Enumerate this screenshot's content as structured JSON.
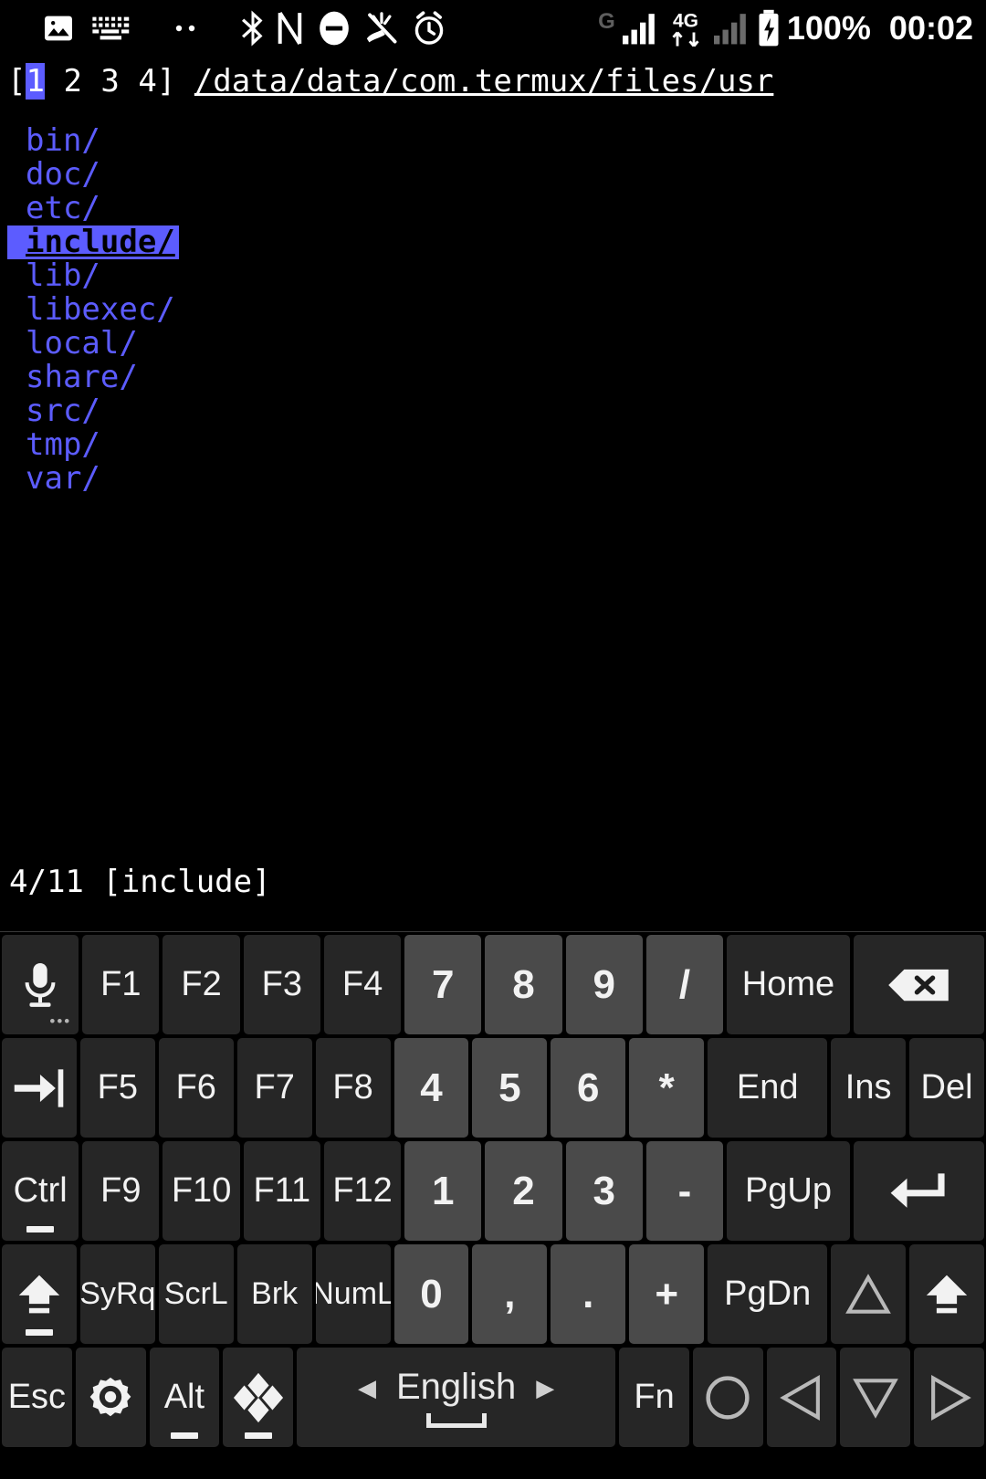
{
  "status_bar": {
    "icons_left": [
      "gallery-icon",
      "keyboard-icon",
      "two-dots-icon",
      "bluetooth-icon",
      "nfc-icon",
      "do-not-disturb-icon",
      "mute-icon",
      "alarm-icon"
    ],
    "icons_right": [
      "g-network-icon",
      "signal-bars-icon",
      "4g-data-icon",
      "signal-bars-2-icon",
      "battery-charging-icon"
    ],
    "battery_text": "100%",
    "clock_text": "00:02"
  },
  "terminal": {
    "tabs_prefix": "[",
    "tabs": [
      "1",
      "2",
      "3",
      "4"
    ],
    "tabs_suffix": "]",
    "active_tab": "1",
    "path": "/data/data/com.termux/files/usr",
    "files": [
      "bin/",
      "doc/",
      "etc/",
      "include/",
      "lib/",
      "libexec/",
      "local/",
      "share/",
      "src/",
      "tmp/",
      "var/"
    ],
    "selected_index": 3,
    "status_line": "4/11 [include]"
  },
  "keyboard": {
    "rows": [
      [
        {
          "name": "mic-key",
          "label": "",
          "icon": "mic-icon",
          "dots": true
        },
        {
          "name": "f1-key",
          "label": "F1"
        },
        {
          "name": "f2-key",
          "label": "F2"
        },
        {
          "name": "f3-key",
          "label": "F3"
        },
        {
          "name": "f4-key",
          "label": "F4"
        },
        {
          "name": "num-7-key",
          "label": "7",
          "style": "num"
        },
        {
          "name": "num-8-key",
          "label": "8",
          "style": "num"
        },
        {
          "name": "num-9-key",
          "label": "9",
          "style": "num"
        },
        {
          "name": "slash-key",
          "label": "/",
          "style": "num"
        },
        {
          "name": "home-key",
          "label": "Home",
          "wide": 1.6
        },
        {
          "name": "backspace-key",
          "label": "",
          "icon": "backspace-icon",
          "wide": 1.7
        }
      ],
      [
        {
          "name": "tab-key",
          "label": "",
          "icon": "tab-icon"
        },
        {
          "name": "f5-key",
          "label": "F5"
        },
        {
          "name": "f6-key",
          "label": "F6"
        },
        {
          "name": "f7-key",
          "label": "F7"
        },
        {
          "name": "f8-key",
          "label": "F8"
        },
        {
          "name": "num-4-key",
          "label": "4",
          "style": "num"
        },
        {
          "name": "num-5-key",
          "label": "5",
          "style": "num"
        },
        {
          "name": "num-6-key",
          "label": "6",
          "style": "num"
        },
        {
          "name": "asterisk-key",
          "label": "*",
          "style": "num"
        },
        {
          "name": "end-key",
          "label": "End",
          "wide": 1.6
        },
        {
          "name": "ins-key",
          "label": "Ins"
        },
        {
          "name": "del-key",
          "label": "Del"
        }
      ],
      [
        {
          "name": "ctrl-key",
          "label": "Ctrl",
          "underbar": true
        },
        {
          "name": "f9-key",
          "label": "F9"
        },
        {
          "name": "f10-key",
          "label": "F10"
        },
        {
          "name": "f11-key",
          "label": "F11"
        },
        {
          "name": "f12-key",
          "label": "F12"
        },
        {
          "name": "num-1-key",
          "label": "1",
          "style": "num"
        },
        {
          "name": "num-2-key",
          "label": "2",
          "style": "num"
        },
        {
          "name": "num-3-key",
          "label": "3",
          "style": "num"
        },
        {
          "name": "minus-key",
          "label": "-",
          "style": "num"
        },
        {
          "name": "pgup-key",
          "label": "PgUp",
          "wide": 1.6
        },
        {
          "name": "enter-key",
          "label": "",
          "icon": "enter-icon",
          "wide": 1.7
        }
      ],
      [
        {
          "name": "shift-key",
          "label": "",
          "icon": "shift-lock-icon",
          "underbar": true
        },
        {
          "name": "sysrq-key",
          "label": "SyRq",
          "style": "small"
        },
        {
          "name": "scrolllock-key",
          "label": "ScrL",
          "style": "small"
        },
        {
          "name": "break-key",
          "label": "Brk",
          "style": "small"
        },
        {
          "name": "numlock-key",
          "label": "NumL",
          "style": "small"
        },
        {
          "name": "num-0-key",
          "label": "0",
          "style": "num"
        },
        {
          "name": "comma-key",
          "label": ",",
          "style": "num"
        },
        {
          "name": "period-key",
          "label": ".",
          "style": "num"
        },
        {
          "name": "plus-key",
          "label": "+",
          "style": "num"
        },
        {
          "name": "pgdn-key",
          "label": "PgDn",
          "wide": 1.6
        },
        {
          "name": "arrow-up-key",
          "label": "",
          "icon": "triangle-up-icon"
        },
        {
          "name": "shift-right-key",
          "label": "",
          "icon": "shift-icon"
        }
      ],
      [
        {
          "name": "esc-key",
          "label": "Esc"
        },
        {
          "name": "settings-key",
          "label": "",
          "icon": "gear-icon"
        },
        {
          "name": "alt-key",
          "label": "Alt",
          "underbar": true
        },
        {
          "name": "symbols-key",
          "label": "",
          "icon": "diamonds-icon",
          "underbar": true
        },
        {
          "name": "space-key",
          "label": "English",
          "icon": "space-lang-icon"
        },
        {
          "name": "fn-key",
          "label": "Fn"
        },
        {
          "name": "circle-key",
          "label": "",
          "icon": "circle-icon"
        },
        {
          "name": "arrow-left-key",
          "label": "",
          "icon": "triangle-left-icon"
        },
        {
          "name": "arrow-down-key",
          "label": "",
          "icon": "triangle-down-icon"
        },
        {
          "name": "arrow-right-key",
          "label": "",
          "icon": "triangle-right-icon"
        }
      ]
    ]
  },
  "colors": {
    "terminal_bg": "#000000",
    "dir_color": "#5c5cff",
    "selection_bg": "#5c5cff",
    "key_bg": "#262626",
    "num_key_bg": "#4a4a4a",
    "text": "#f2f2f2"
  }
}
